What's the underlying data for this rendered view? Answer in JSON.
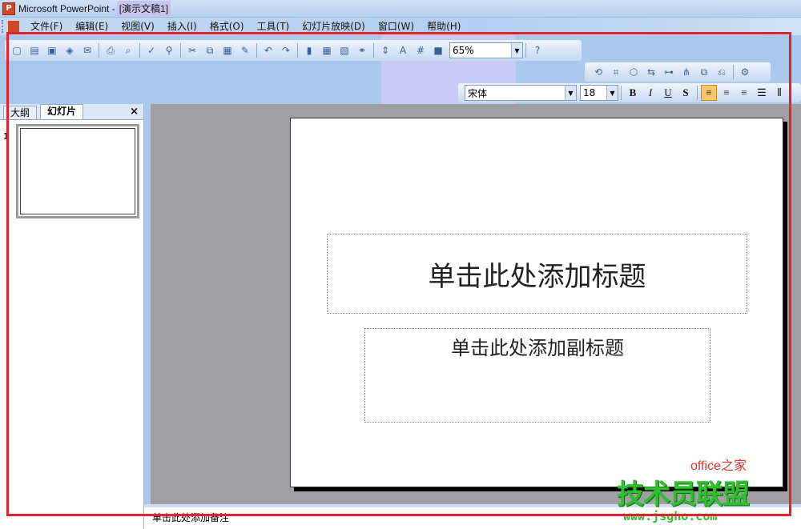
{
  "window": {
    "app_title": "Microsoft PowerPoint - ",
    "doc_title": "[演示文稿1]"
  },
  "menu": [
    {
      "label": "文件(F)"
    },
    {
      "label": "编辑(E)"
    },
    {
      "label": "视图(V)"
    },
    {
      "label": "插入(I)"
    },
    {
      "label": "格式(O)"
    },
    {
      "label": "工具(T)"
    },
    {
      "label": "幻灯片放映(D)"
    },
    {
      "label": "窗口(W)"
    },
    {
      "label": "帮助(H)"
    }
  ],
  "standard_toolbar": {
    "zoom_value": "65%",
    "buttons": [
      "new-icon",
      "open-icon",
      "save-icon",
      "permission-icon",
      "email-icon",
      "print-icon",
      "print-preview-icon",
      "spelling-icon",
      "research-icon",
      "cut-icon",
      "copy-icon",
      "paste-icon",
      "format-painter-icon",
      "undo-icon",
      "redo-icon",
      "chart-icon",
      "table-icon",
      "tables-borders-icon",
      "hyperlink-icon",
      "expand-icon",
      "show-formatting-icon",
      "grid-icon",
      "color-icon",
      "help-icon"
    ]
  },
  "formatting_toolbar": {
    "font_name": "宋体",
    "font_size": "18",
    "bold": "B",
    "italic": "I",
    "underline": "U",
    "shadow": "S"
  },
  "left_panel": {
    "tab_outline": "大纲",
    "tab_slides": "幻灯片",
    "close": "×",
    "slide_number": "1"
  },
  "slide": {
    "title_placeholder": "单击此处添加标题",
    "subtitle_placeholder": "单击此处添加副标题"
  },
  "notes": {
    "placeholder": "单击此处添加备注"
  },
  "watermark": {
    "line1": "office之家",
    "line2": "技术员联盟",
    "line3": "www.jsgho.com"
  },
  "colors": {
    "highlight_frame": "#e3232b",
    "workspace": "#a0a0a4",
    "toolbar_blue": "#c6d9f3"
  }
}
